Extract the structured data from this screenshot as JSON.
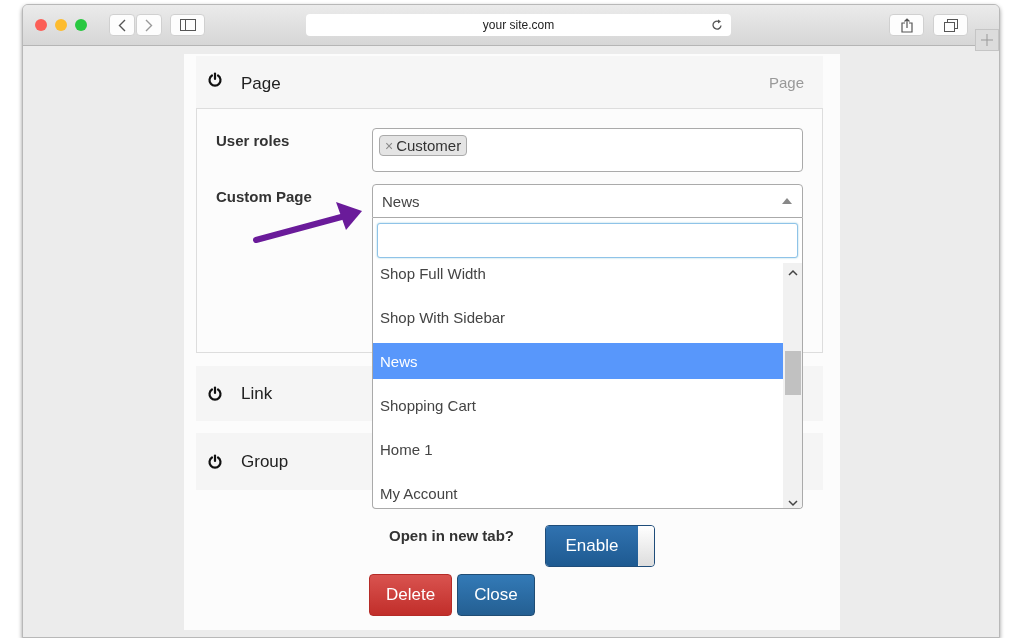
{
  "browser": {
    "url": "your site.com"
  },
  "sections": [
    {
      "title": "Page",
      "subtitle": "Page",
      "expanded": true
    },
    {
      "title": "Link",
      "expanded": false
    },
    {
      "title": "Group",
      "expanded": false
    }
  ],
  "form": {
    "user_roles": {
      "label": "User roles",
      "tags": [
        {
          "remove": "×",
          "text": "Customer"
        }
      ]
    },
    "custom_page": {
      "label": "Custom Page",
      "value": "News",
      "expanded": true,
      "options": [
        {
          "label": "Shop Full Width",
          "selected": false
        },
        {
          "label": "Shop With Sidebar",
          "selected": false
        },
        {
          "label": "News",
          "selected": true
        },
        {
          "label": "Shopping Cart",
          "selected": false
        },
        {
          "label": "Home 1",
          "selected": false
        },
        {
          "label": "My Account",
          "selected": false
        }
      ]
    }
  },
  "open_new_tab": {
    "label": "Open in new tab?",
    "toggle": {
      "label": "Enable",
      "on": true
    }
  },
  "buttons": [
    {
      "label": "Delete",
      "kind": "danger"
    },
    {
      "label": "Close",
      "kind": "primary"
    }
  ]
}
